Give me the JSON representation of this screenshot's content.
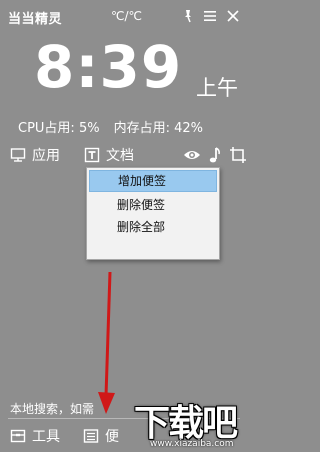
{
  "header": {
    "app_title": "当当精灵",
    "temperature": "℃/℃",
    "pin_icon": "pin-icon",
    "menu_icon": "hamburger-icon",
    "close_icon": "close-icon"
  },
  "clock": {
    "time": "8:39",
    "period": "上午"
  },
  "stats": {
    "cpu": "CPU占用: 5%",
    "mem": "内存占用: 42%"
  },
  "toolbar": {
    "apps_label": "应用",
    "docs_label": "文档",
    "apps_icon": "monitor-icon",
    "docs_icon": "text-doc-icon",
    "eye_icon": "eye-icon",
    "music_icon": "music-note-icon",
    "crop_icon": "crop-icon"
  },
  "context_menu": {
    "items": [
      "增加便签",
      "删除便签",
      "删除全部"
    ],
    "highlighted_index": 0
  },
  "search": {
    "placeholder": "本地搜索，如需"
  },
  "bottombar": {
    "tools_label": "工具",
    "notes_label": "便",
    "tools_icon": "toolbox-icon",
    "notes_icon": "note-icon"
  },
  "watermark": {
    "text": "下载吧",
    "url": "www.xiazaiba.com"
  },
  "colors": {
    "background": "#8e8e8e",
    "menu_highlight": "#99c9ef",
    "arrow": "#d01818"
  }
}
